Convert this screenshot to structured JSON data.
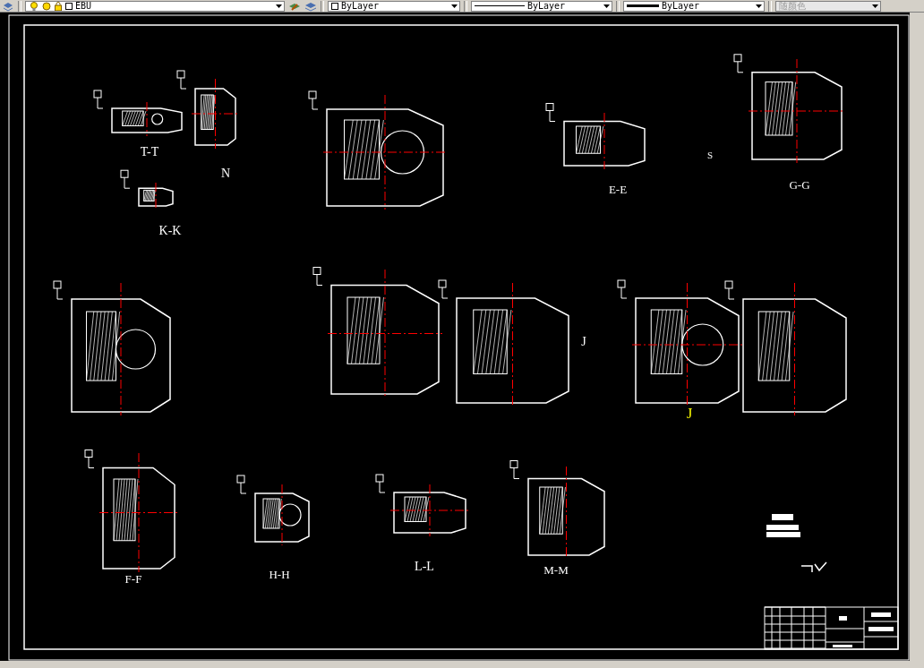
{
  "toolbar": {
    "layer": {
      "name": "EBU"
    },
    "properties": [
      {
        "kind": "color",
        "value": "ByLayer"
      },
      {
        "kind": "linetype",
        "value": "ByLayer"
      },
      {
        "kind": "lineweight",
        "value": "ByLayer"
      }
    ],
    "plot_style": {
      "value": "随颜色",
      "disabled": true
    }
  },
  "drawing": {
    "section_labels": [
      "T-T",
      "N",
      "K-K",
      "E-E",
      "S",
      "G-G",
      "J",
      "J",
      "F-F",
      "H-H",
      "L-L",
      "M-M"
    ]
  }
}
